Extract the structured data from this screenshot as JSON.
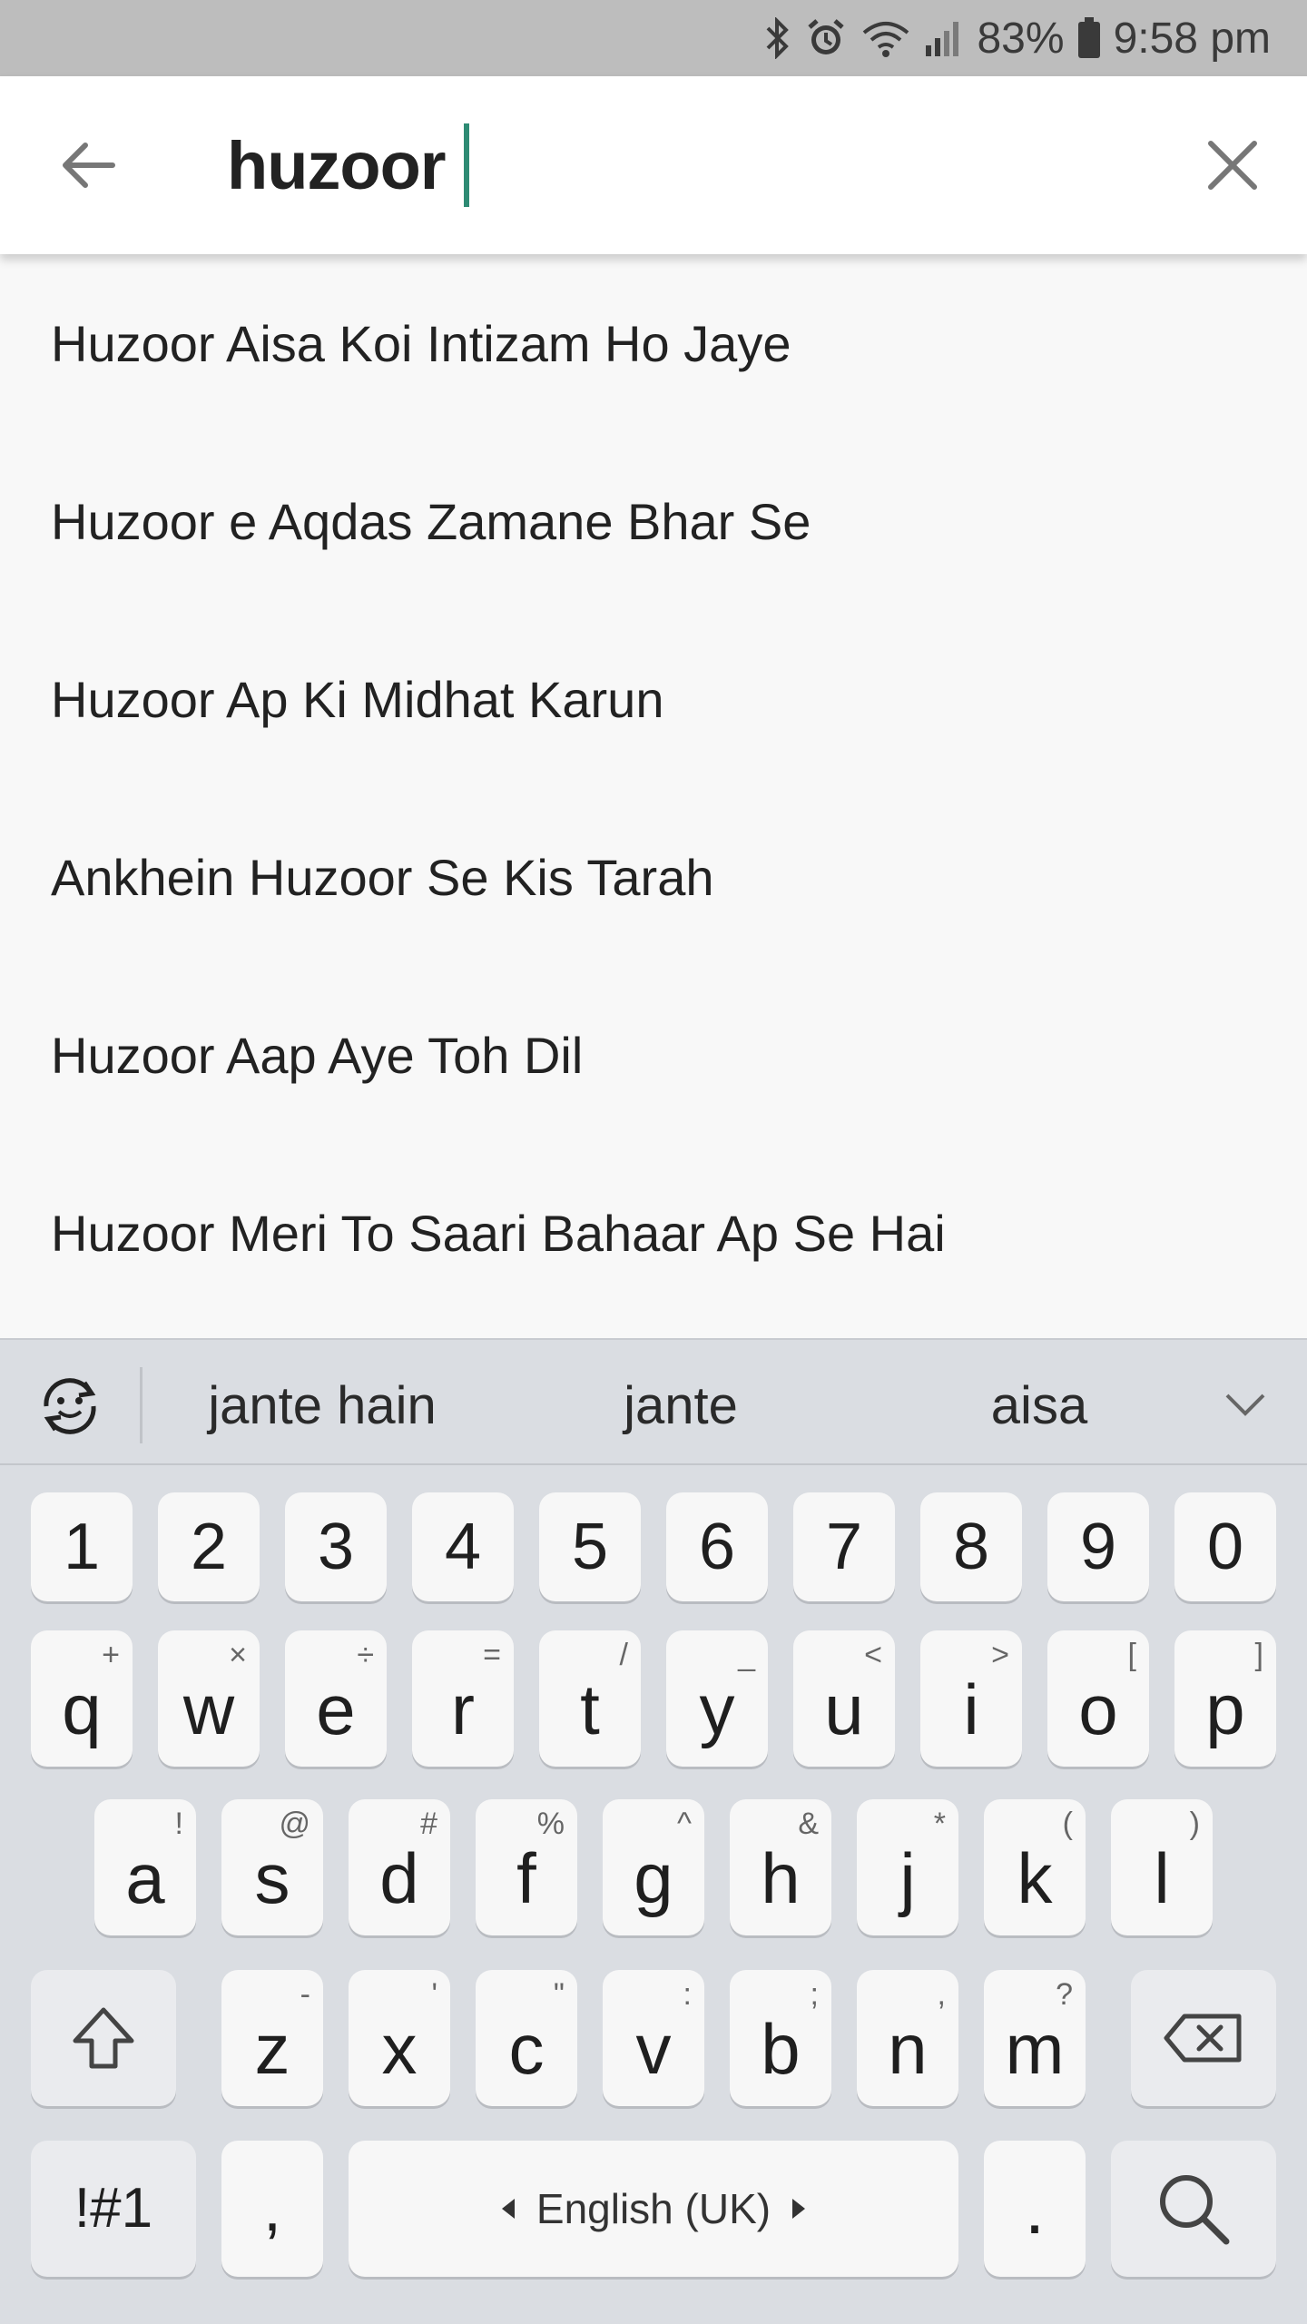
{
  "status_bar": {
    "battery": "83%",
    "time": "9:58 pm",
    "icons": [
      "bluetooth-icon",
      "alarm-icon",
      "wifi-icon",
      "signal-icon",
      "battery-icon"
    ]
  },
  "search": {
    "query": "huzoor",
    "back_icon": "arrow-left-icon",
    "clear_icon": "close-icon",
    "caret_color": "#2e8b74"
  },
  "suggestions": [
    "Huzoor Aisa Koi Intizam Ho Jaye",
    "Huzoor e Aqdas Zamane Bhar Se",
    "Huzoor Ap Ki Midhat Karun",
    "Ankhein Huzoor Se Kis Tarah",
    "Huzoor Aap Aye Toh Dil",
    "Huzoor Meri To Saari Bahaar Ap Se Hai"
  ],
  "keyboard": {
    "predictions": [
      "jante hain",
      "jante",
      "aisa"
    ],
    "number_row": [
      "1",
      "2",
      "3",
      "4",
      "5",
      "6",
      "7",
      "8",
      "9",
      "0"
    ],
    "row1": [
      {
        "key": "q",
        "hint": "+"
      },
      {
        "key": "w",
        "hint": "×"
      },
      {
        "key": "e",
        "hint": "÷"
      },
      {
        "key": "r",
        "hint": "="
      },
      {
        "key": "t",
        "hint": "/"
      },
      {
        "key": "y",
        "hint": "_"
      },
      {
        "key": "u",
        "hint": "<"
      },
      {
        "key": "i",
        "hint": ">"
      },
      {
        "key": "o",
        "hint": "["
      },
      {
        "key": "p",
        "hint": "]"
      }
    ],
    "row2": [
      {
        "key": "a",
        "hint": "!"
      },
      {
        "key": "s",
        "hint": "@"
      },
      {
        "key": "d",
        "hint": "#"
      },
      {
        "key": "f",
        "hint": "%"
      },
      {
        "key": "g",
        "hint": "^"
      },
      {
        "key": "h",
        "hint": "&"
      },
      {
        "key": "j",
        "hint": "*"
      },
      {
        "key": "k",
        "hint": "("
      },
      {
        "key": "l",
        "hint": ")"
      }
    ],
    "row3": [
      {
        "key": "z",
        "hint": "-"
      },
      {
        "key": "x",
        "hint": "'"
      },
      {
        "key": "c",
        "hint": "\""
      },
      {
        "key": "v",
        "hint": ":"
      },
      {
        "key": "b",
        "hint": ";"
      },
      {
        "key": "n",
        "hint": ","
      },
      {
        "key": "m",
        "hint": "?"
      }
    ],
    "symbols_label": "!#1",
    "comma_label": ",",
    "space_label": "English (UK)",
    "period_label": "."
  }
}
